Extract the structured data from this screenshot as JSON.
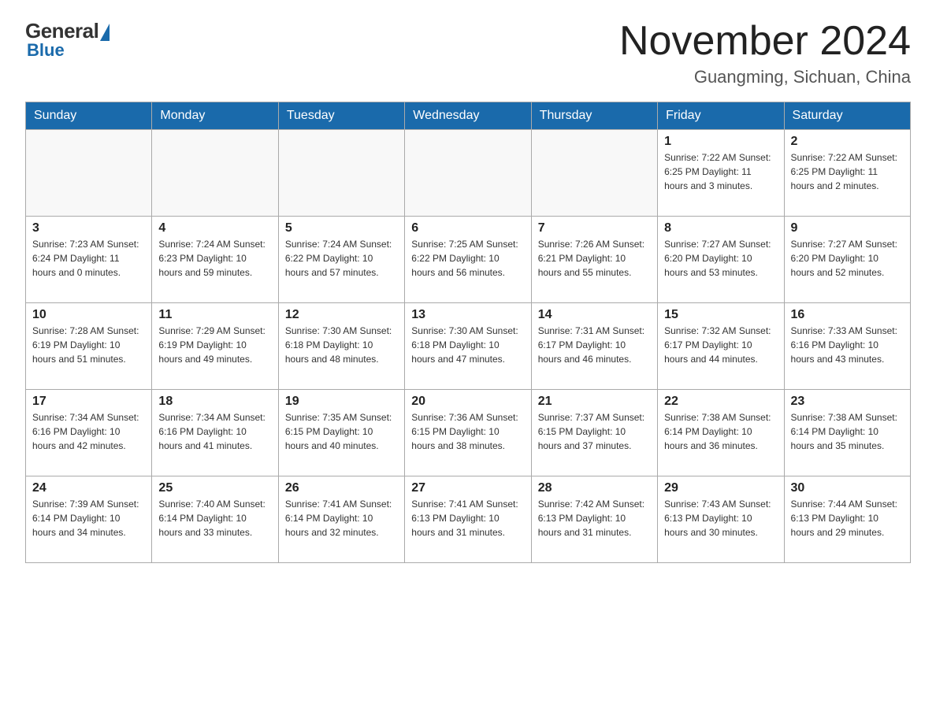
{
  "header": {
    "logo_general": "General",
    "logo_blue": "Blue",
    "month_title": "November 2024",
    "location": "Guangming, Sichuan, China"
  },
  "weekdays": [
    "Sunday",
    "Monday",
    "Tuesday",
    "Wednesday",
    "Thursday",
    "Friday",
    "Saturday"
  ],
  "weeks": [
    [
      {
        "day": "",
        "info": ""
      },
      {
        "day": "",
        "info": ""
      },
      {
        "day": "",
        "info": ""
      },
      {
        "day": "",
        "info": ""
      },
      {
        "day": "",
        "info": ""
      },
      {
        "day": "1",
        "info": "Sunrise: 7:22 AM\nSunset: 6:25 PM\nDaylight: 11 hours\nand 3 minutes."
      },
      {
        "day": "2",
        "info": "Sunrise: 7:22 AM\nSunset: 6:25 PM\nDaylight: 11 hours\nand 2 minutes."
      }
    ],
    [
      {
        "day": "3",
        "info": "Sunrise: 7:23 AM\nSunset: 6:24 PM\nDaylight: 11 hours\nand 0 minutes."
      },
      {
        "day": "4",
        "info": "Sunrise: 7:24 AM\nSunset: 6:23 PM\nDaylight: 10 hours\nand 59 minutes."
      },
      {
        "day": "5",
        "info": "Sunrise: 7:24 AM\nSunset: 6:22 PM\nDaylight: 10 hours\nand 57 minutes."
      },
      {
        "day": "6",
        "info": "Sunrise: 7:25 AM\nSunset: 6:22 PM\nDaylight: 10 hours\nand 56 minutes."
      },
      {
        "day": "7",
        "info": "Sunrise: 7:26 AM\nSunset: 6:21 PM\nDaylight: 10 hours\nand 55 minutes."
      },
      {
        "day": "8",
        "info": "Sunrise: 7:27 AM\nSunset: 6:20 PM\nDaylight: 10 hours\nand 53 minutes."
      },
      {
        "day": "9",
        "info": "Sunrise: 7:27 AM\nSunset: 6:20 PM\nDaylight: 10 hours\nand 52 minutes."
      }
    ],
    [
      {
        "day": "10",
        "info": "Sunrise: 7:28 AM\nSunset: 6:19 PM\nDaylight: 10 hours\nand 51 minutes."
      },
      {
        "day": "11",
        "info": "Sunrise: 7:29 AM\nSunset: 6:19 PM\nDaylight: 10 hours\nand 49 minutes."
      },
      {
        "day": "12",
        "info": "Sunrise: 7:30 AM\nSunset: 6:18 PM\nDaylight: 10 hours\nand 48 minutes."
      },
      {
        "day": "13",
        "info": "Sunrise: 7:30 AM\nSunset: 6:18 PM\nDaylight: 10 hours\nand 47 minutes."
      },
      {
        "day": "14",
        "info": "Sunrise: 7:31 AM\nSunset: 6:17 PM\nDaylight: 10 hours\nand 46 minutes."
      },
      {
        "day": "15",
        "info": "Sunrise: 7:32 AM\nSunset: 6:17 PM\nDaylight: 10 hours\nand 44 minutes."
      },
      {
        "day": "16",
        "info": "Sunrise: 7:33 AM\nSunset: 6:16 PM\nDaylight: 10 hours\nand 43 minutes."
      }
    ],
    [
      {
        "day": "17",
        "info": "Sunrise: 7:34 AM\nSunset: 6:16 PM\nDaylight: 10 hours\nand 42 minutes."
      },
      {
        "day": "18",
        "info": "Sunrise: 7:34 AM\nSunset: 6:16 PM\nDaylight: 10 hours\nand 41 minutes."
      },
      {
        "day": "19",
        "info": "Sunrise: 7:35 AM\nSunset: 6:15 PM\nDaylight: 10 hours\nand 40 minutes."
      },
      {
        "day": "20",
        "info": "Sunrise: 7:36 AM\nSunset: 6:15 PM\nDaylight: 10 hours\nand 38 minutes."
      },
      {
        "day": "21",
        "info": "Sunrise: 7:37 AM\nSunset: 6:15 PM\nDaylight: 10 hours\nand 37 minutes."
      },
      {
        "day": "22",
        "info": "Sunrise: 7:38 AM\nSunset: 6:14 PM\nDaylight: 10 hours\nand 36 minutes."
      },
      {
        "day": "23",
        "info": "Sunrise: 7:38 AM\nSunset: 6:14 PM\nDaylight: 10 hours\nand 35 minutes."
      }
    ],
    [
      {
        "day": "24",
        "info": "Sunrise: 7:39 AM\nSunset: 6:14 PM\nDaylight: 10 hours\nand 34 minutes."
      },
      {
        "day": "25",
        "info": "Sunrise: 7:40 AM\nSunset: 6:14 PM\nDaylight: 10 hours\nand 33 minutes."
      },
      {
        "day": "26",
        "info": "Sunrise: 7:41 AM\nSunset: 6:14 PM\nDaylight: 10 hours\nand 32 minutes."
      },
      {
        "day": "27",
        "info": "Sunrise: 7:41 AM\nSunset: 6:13 PM\nDaylight: 10 hours\nand 31 minutes."
      },
      {
        "day": "28",
        "info": "Sunrise: 7:42 AM\nSunset: 6:13 PM\nDaylight: 10 hours\nand 31 minutes."
      },
      {
        "day": "29",
        "info": "Sunrise: 7:43 AM\nSunset: 6:13 PM\nDaylight: 10 hours\nand 30 minutes."
      },
      {
        "day": "30",
        "info": "Sunrise: 7:44 AM\nSunset: 6:13 PM\nDaylight: 10 hours\nand 29 minutes."
      }
    ]
  ]
}
